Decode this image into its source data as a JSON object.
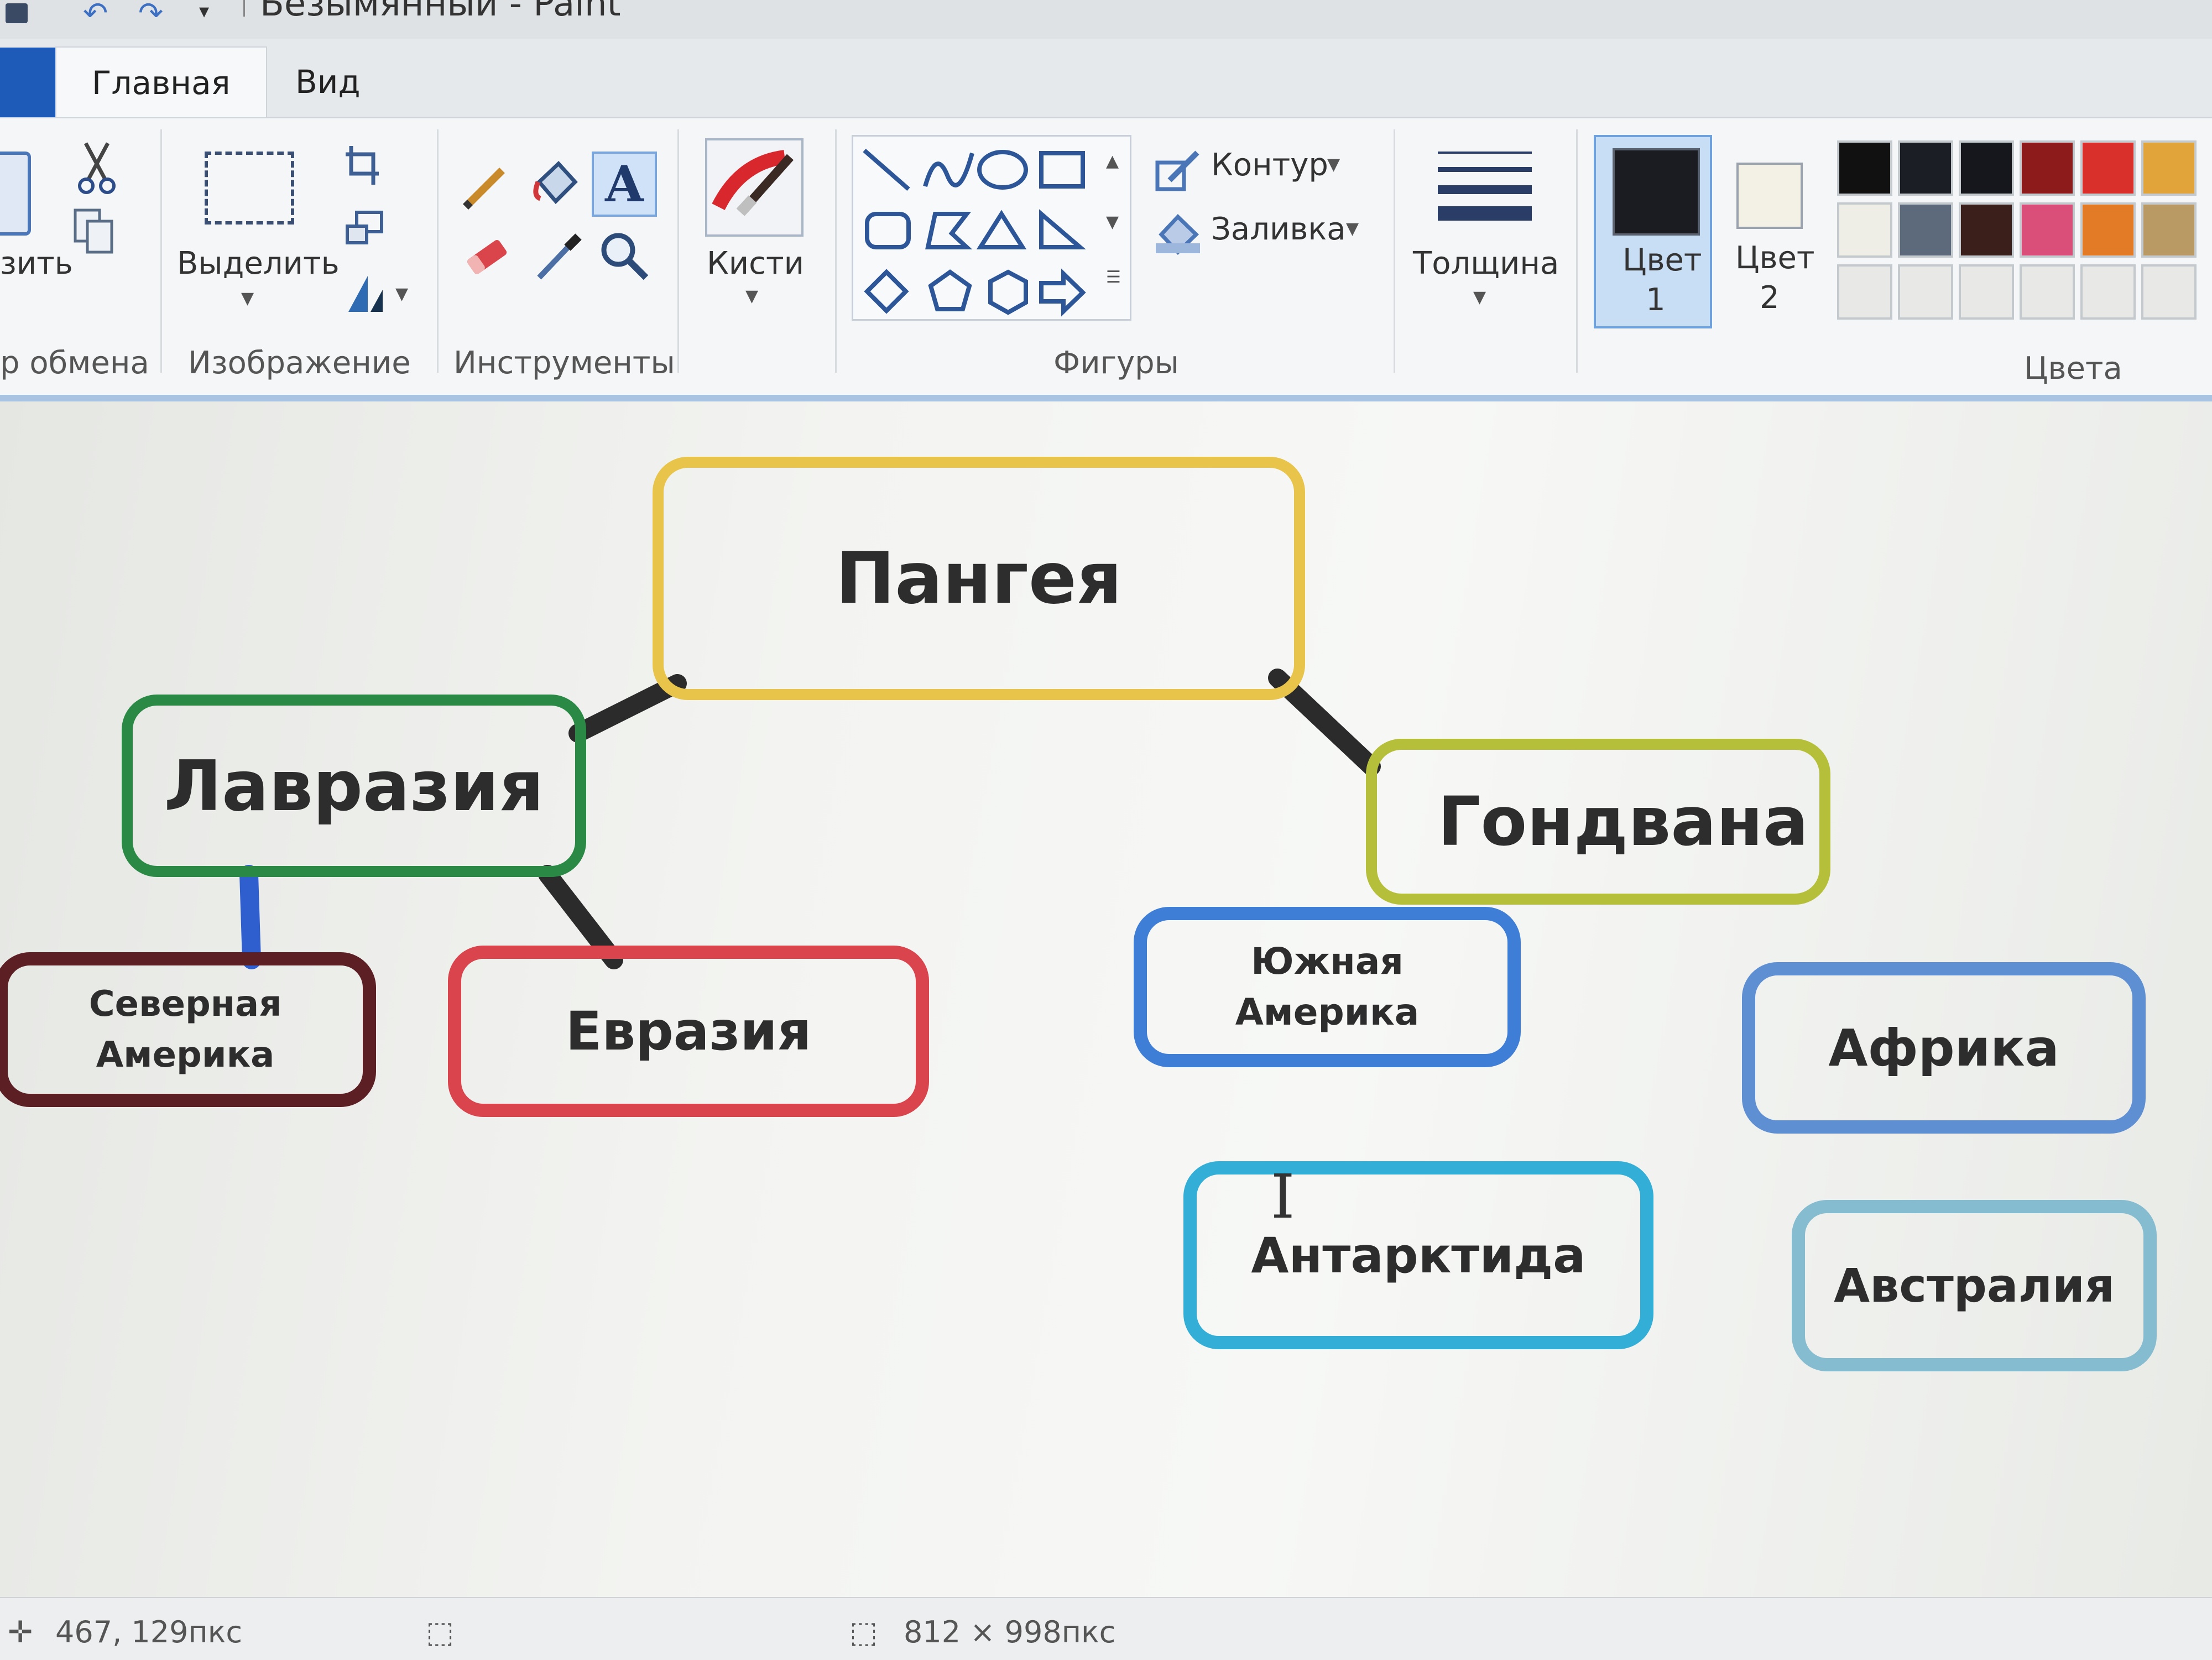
{
  "window": {
    "title": "Безымянный - Paint"
  },
  "tabs": [
    {
      "label": "Главная",
      "active": true
    },
    {
      "label": "Вид",
      "active": false
    }
  ],
  "ribbon": {
    "clipboard": {
      "paste_label": "зить",
      "group_label": "р обмена"
    },
    "image": {
      "select_label": "Выделить",
      "group_label": "Изображение"
    },
    "tools": {
      "group_label": "Инструменты"
    },
    "brushes": {
      "label": "Кисти"
    },
    "shapes": {
      "outline_label": "Контур",
      "fill_label": "Заливка",
      "group_label": "Фигуры"
    },
    "size": {
      "label": "Толщина"
    },
    "colors": {
      "color1_label_a": "Цвет",
      "color1_label_b": "1",
      "color2_label_a": "Цвет",
      "color2_label_b": "2",
      "group_label": "Цвета",
      "color1": "#1a1c22",
      "color2": "#f3f0e6",
      "palette_row1": [
        "#111111",
        "#1c1e26",
        "#15171d",
        "#8e1b1b",
        "#d9302b",
        "#e0a43a"
      ],
      "palette_row2": [
        "#eeeee6",
        "#5d6a7c",
        "#3a1f1a",
        "#d94f7a",
        "#e27a26",
        "#b99a64"
      ],
      "palette_row3": [
        "#e8e9e6",
        "#e8e9e6",
        "#e8e9e6",
        "#e8e9e6",
        "#e8e9e6",
        "#e8e9e6"
      ]
    }
  },
  "canvas": {
    "nodes": [
      {
        "id": "pangea",
        "label": "Пангея",
        "color": "#e8c44a"
      },
      {
        "id": "laurasia",
        "label": "Лавразия",
        "color": "#2a8a45"
      },
      {
        "id": "gondwana",
        "label": "Гондвана",
        "color": "#b6bf3a"
      },
      {
        "id": "north-america",
        "label_a": "Северная",
        "label_b": "Америка",
        "color": "#5c1f24"
      },
      {
        "id": "eurasia",
        "label": "Евразия",
        "color": "#d9444d"
      },
      {
        "id": "south-america",
        "label_a": "Южная",
        "label_b": "Америка",
        "color": "#3e7ed6"
      },
      {
        "id": "africa",
        "label": "Африка",
        "color": "#5f8fd3"
      },
      {
        "id": "antarctica",
        "label": "Антарктида",
        "color": "#33aed6"
      },
      {
        "id": "australia",
        "label": "Австралия",
        "color": "#86bcd0"
      }
    ],
    "connector_colors": {
      "dark": "#2b2b2b",
      "blue": "#2f5fcf"
    }
  },
  "status": {
    "cursor_position": "467, 129пкс",
    "image_size": "812 × 998пкс"
  }
}
